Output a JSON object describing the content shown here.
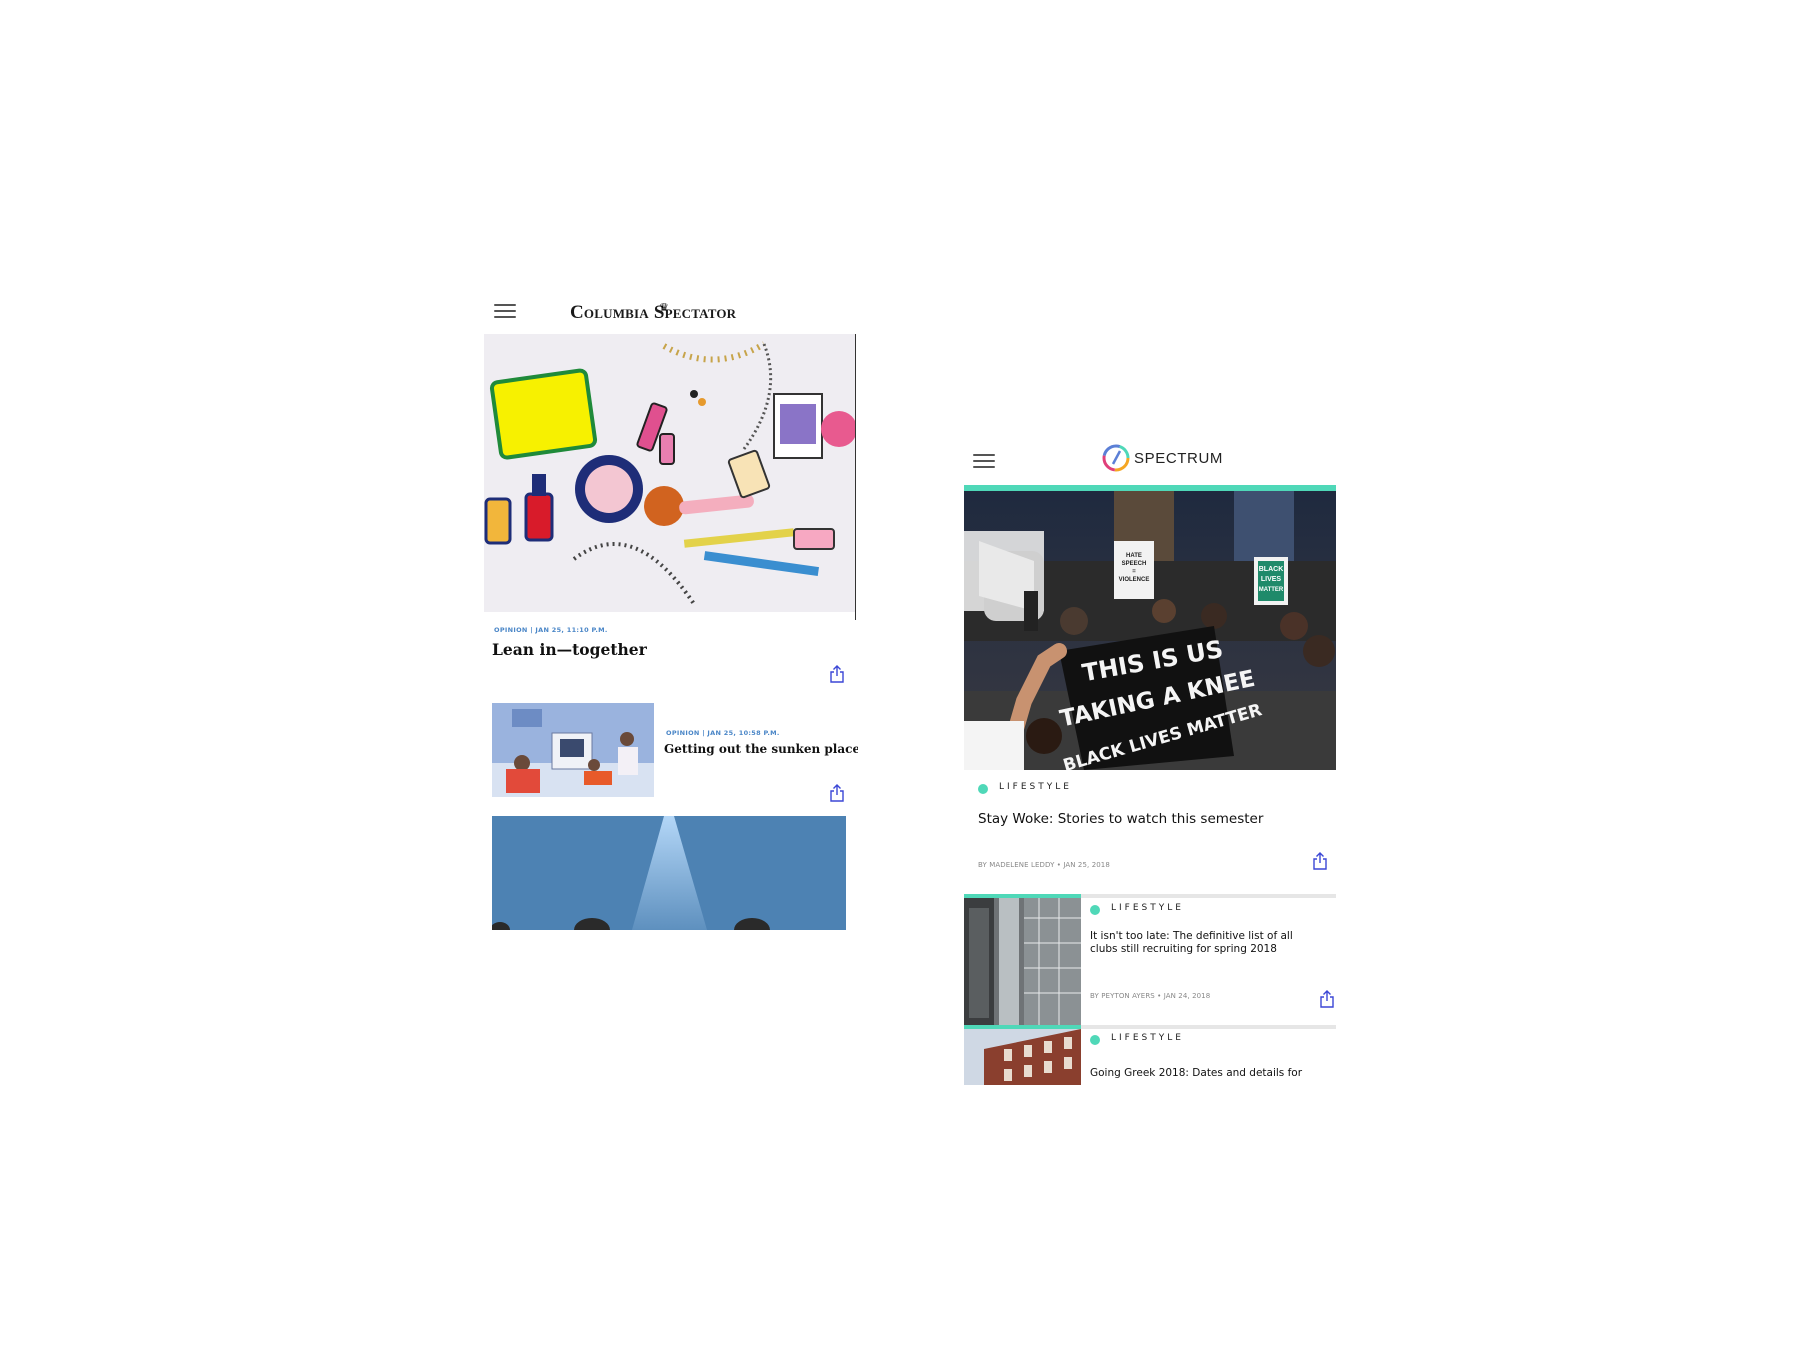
{
  "spectator": {
    "logo_text": "Columbia Spectator",
    "lead": {
      "meta": "OPINION | JAN 25, 11:10 P.M.",
      "headline": "Lean in—together"
    },
    "second": {
      "meta": "OPINION | JAN 25, 10:58 P.M.",
      "headline": "Getting out the sunken place"
    },
    "icons": {
      "menu": "hamburger-menu-icon",
      "share": "share-icon",
      "crown": "crown-icon"
    },
    "colors": {
      "meta": "#4a86c7",
      "share": "#3b47d6"
    }
  },
  "spectrum": {
    "logo_text": "SPECTRUM",
    "lead": {
      "category": "LIFESTYLE",
      "headline": "Stay Woke: Stories to watch this semester",
      "byline": "BY MADELENE LEDDY • JAN 25, 2018"
    },
    "articles": [
      {
        "category": "LIFESTYLE",
        "headline_line1": "It isn't too late: The definitive list of all",
        "headline_line2": "clubs still recruiting for spring 2018",
        "byline": "BY PEYTON AYERS • JAN 24, 2018"
      },
      {
        "category": "LIFESTYLE",
        "headline_line1": "Going Greek 2018: Dates and details for"
      }
    ],
    "protest_signs": {
      "sign1": [
        "HATE",
        "SPEECH",
        "=",
        "VIOLENCE"
      ],
      "sign2": [
        "BLACK",
        "LIVES",
        "MATTER"
      ],
      "banner_line1": "THIS IS US",
      "banner_line2": "TAKING A KNEE",
      "banner_line3": "BLACK LIVES MATTER"
    },
    "icons": {
      "menu": "hamburger-menu-icon",
      "share": "share-icon",
      "logo": "spectrum-logo-icon"
    },
    "colors": {
      "accent": "#4fd8b8",
      "share": "#3b47d6"
    }
  }
}
